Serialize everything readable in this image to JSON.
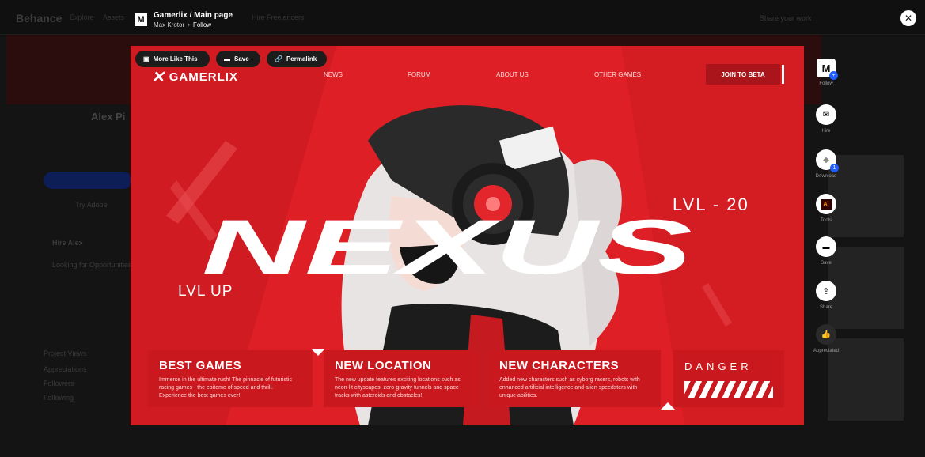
{
  "background": {
    "logo": "Behance",
    "nav": [
      "Explore",
      "Assets"
    ],
    "nav_center": "Hire Freelancers",
    "right_link": "Share your work",
    "profile_name": "Alex Pi",
    "cta_label": "Try Adobe",
    "side_heading": "Hire Alex",
    "side_subheading": "Looking for Opportunities",
    "stats": [
      "Project Views",
      "Appreciations",
      "Followers",
      "Following"
    ]
  },
  "modal": {
    "project_title": "Gamerlix / Main page",
    "author": "Max Krotor",
    "separator": "•",
    "follow_label": "Follow",
    "logo_letter": "M"
  },
  "actions": {
    "more_like_this": "More Like This",
    "save": "Save",
    "permalink": "Permalink"
  },
  "artwork": {
    "brand": "GAMERLIX",
    "nav": [
      "NEWS",
      "FORUM",
      "ABOUT US",
      "OTHER GAMES"
    ],
    "cta": "JOIN TO BETA",
    "hero_title": "NEXUS",
    "level": "LVL - 20",
    "level_up": "LVL UP",
    "cards": [
      {
        "title": "BEST GAMES",
        "text": "Immerse in the ultimate rush! The pinnacle of futuristic racing games - the epitome of speed and thrill. Experience the best games ever!"
      },
      {
        "title": "NEW LOCATION",
        "text": "The new update features exciting locations such as neon-lit cityscapes, zero-gravity tunnels and space tracks with asteroids and obstacles!"
      },
      {
        "title": "NEW CHARACTERS",
        "text": "Added new characters such as cyborg racers, robots with enhanced artificial intelligence and alien speedsters with unique abilities."
      }
    ],
    "badge": "DANGER"
  },
  "rail": [
    {
      "label": "Follow",
      "icon": "behance-logo-icon"
    },
    {
      "label": "Hire",
      "icon": "mail-icon"
    },
    {
      "label": "Download",
      "icon": "download-icon"
    },
    {
      "label": "Tools",
      "icon": "adobe-illustrator-icon"
    },
    {
      "label": "Save",
      "icon": "folder-icon"
    },
    {
      "label": "Share",
      "icon": "share-icon"
    },
    {
      "label": "Appreciated",
      "icon": "thumbs-up-icon"
    }
  ],
  "colors": {
    "art_red": "#df1f26",
    "panel_red": "#c9191f",
    "accent_blue": "#1f5dff"
  }
}
